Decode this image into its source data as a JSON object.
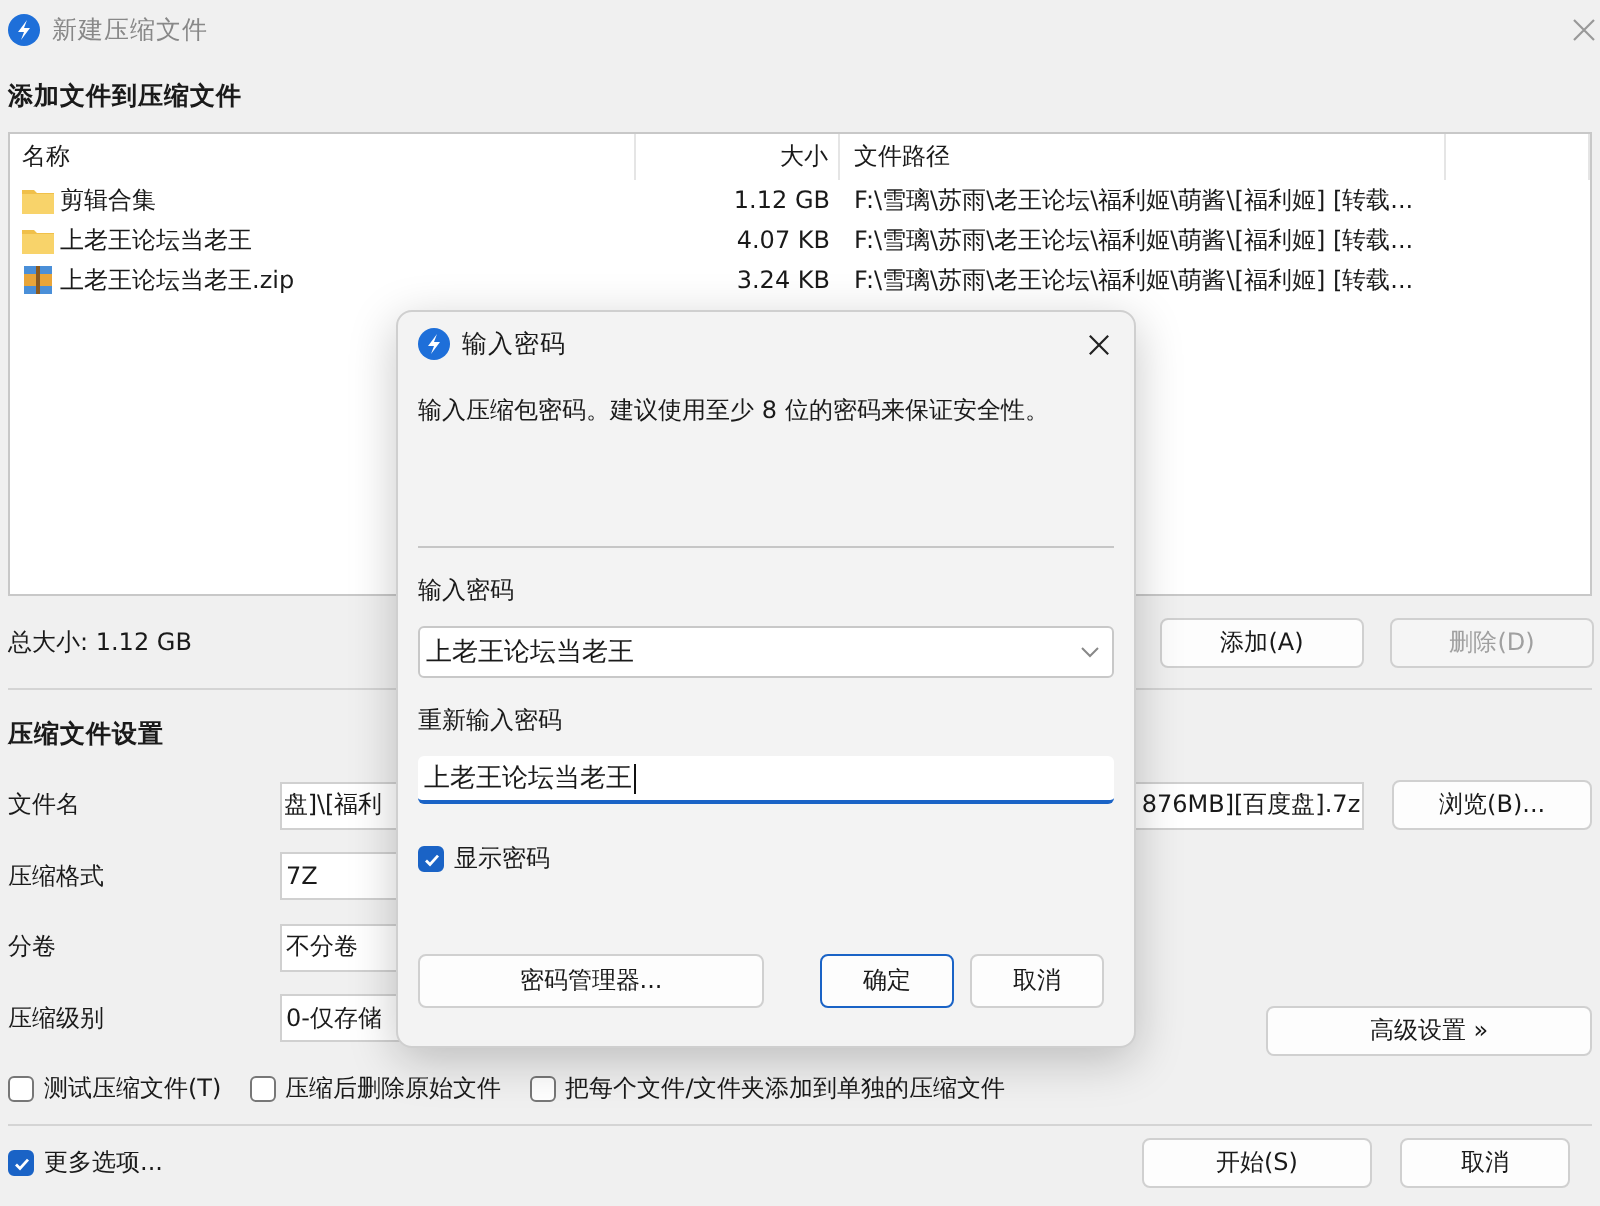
{
  "window": {
    "title": "新建压缩文件"
  },
  "files": {
    "heading": "添加文件到压缩文件",
    "columns": [
      "名称",
      "大小",
      "文件路径"
    ],
    "rows": [
      {
        "kind": "folder",
        "name": "剪辑合集",
        "size": "1.12 GB",
        "path": "F:\\雪璃\\苏雨\\老王论坛\\福利姬\\萌酱\\[福利姬] [转载..."
      },
      {
        "kind": "folder",
        "name": "上老王论坛当老王",
        "size": "4.07 KB",
        "path": "F:\\雪璃\\苏雨\\老王论坛\\福利姬\\萌酱\\[福利姬] [转载..."
      },
      {
        "kind": "archive",
        "name": "上老王论坛当老王.zip",
        "size": "3.24 KB",
        "path": "F:\\雪璃\\苏雨\\老王论坛\\福利姬\\萌酱\\[福利姬] [转载..."
      }
    ],
    "total": "总大小: 1.12 GB",
    "buttons": [
      {
        "label": "添加(A)",
        "disabled": false
      },
      {
        "label": "删除(D)",
        "disabled": true
      }
    ]
  },
  "settings": {
    "heading": "压缩文件设置",
    "filename": {
      "label": "文件名",
      "value_start": "盘]\\[福利",
      "value_end": "876MB][百度盘].7z",
      "button": "浏览(B)..."
    },
    "fields": [
      {
        "label": "压缩格式",
        "value": "7Z"
      },
      {
        "label": "分卷",
        "value": "不分卷"
      },
      {
        "label": "压缩级别",
        "value": "0-仅存储"
      }
    ],
    "advanced": "高级设置 »",
    "options": [
      {
        "label": "测试压缩文件(T)",
        "checked": false
      },
      {
        "label": "压缩后删除原始文件",
        "checked": false
      },
      {
        "label": "把每个文件/文件夹添加到单独的压缩文件",
        "checked": false
      }
    ]
  },
  "footer": {
    "more": {
      "label": "更多选项...",
      "checked": true
    },
    "buttons": [
      "开始(S)",
      "取消"
    ]
  },
  "dialog": {
    "title": "输入密码",
    "description": "输入压缩包密码。建议使用至少 8 位的密码来保证安全性。",
    "password_label": "输入密码",
    "password": "上老王论坛当老王",
    "repeat_label": "重新输入密码",
    "repeat": {
      "value": "上老王论坛当老王",
      "focused": true
    },
    "show_password": {
      "label": "显示密码",
      "checked": true
    },
    "buttons": [
      {
        "label": "密码管理器...",
        "default": false
      },
      {
        "label": "确定",
        "default": true
      },
      {
        "label": "取消",
        "default": false
      }
    ]
  }
}
